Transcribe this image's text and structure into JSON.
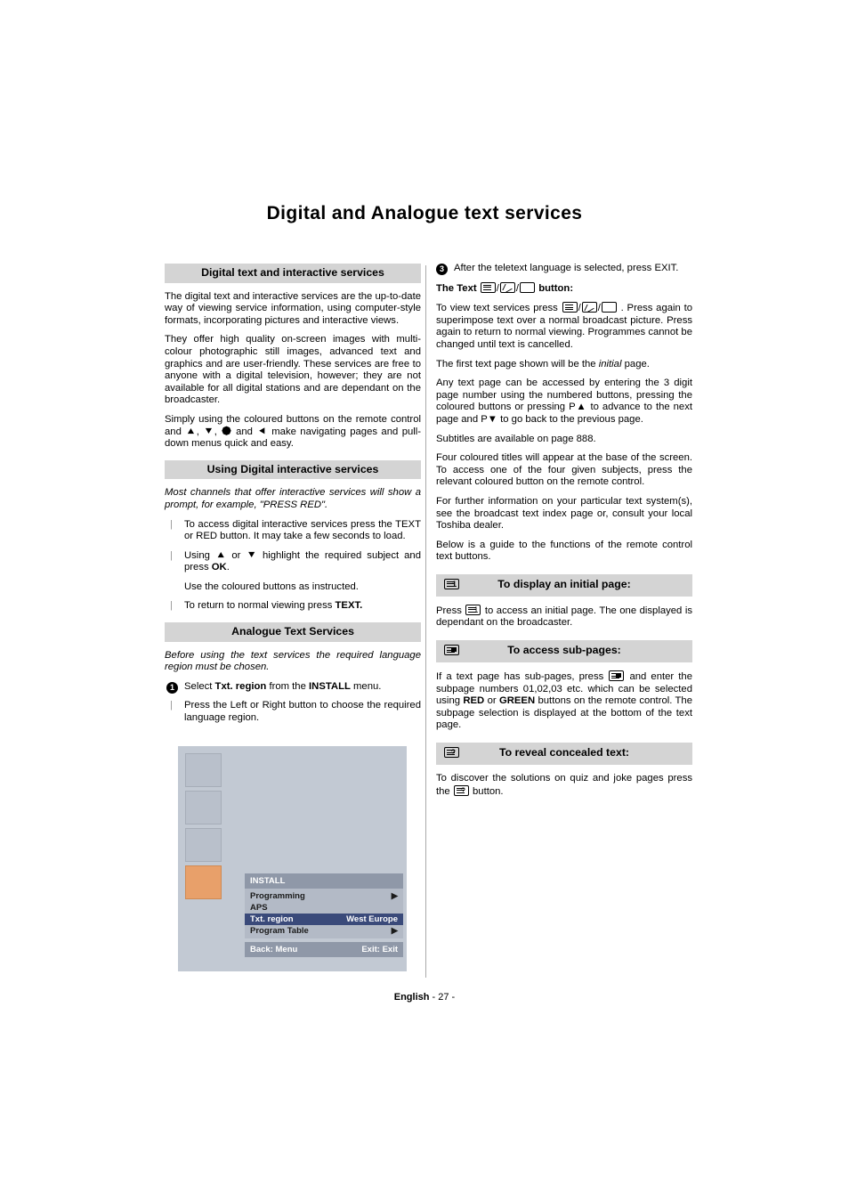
{
  "page": {
    "title": "Digital and Analogue text services",
    "footer_lang": "English",
    "footer_page": "- 27 -"
  },
  "left_column": {
    "sections": [
      {
        "heading": "Digital text and interactive services",
        "paragraphs": [
          "The digital text and interactive services are the up-to-date way of viewing service information, using computer-style formats, incorporating pictures and interactive views.",
          "They offer high quality on-screen images with multi-colour photographic still images, advanced text and graphics and are user-friendly. These services are free to anyone with a digital television, however; they are not available for all digital stations and are dependant on the broadcaster."
        ],
        "nav_text_before": "Simply using the coloured buttons on the remote control and",
        "nav_text_mid": "and",
        "nav_text_after": "make navigating pages and pull-down menus quick and easy."
      },
      {
        "heading": "Using Digital interactive services",
        "intro": "Most channels that offer interactive services will show a prompt, for example, \"PRESS RED\".",
        "items": [
          "To access digital interactive services press the TEXT or RED button. It may take a few seconds to load.",
          "Use the coloured buttons as instructed."
        ],
        "item_using_pre": "Using",
        "item_using_or": "or",
        "item_using_post": "highlight the required subject and press",
        "item_using_ok": "OK",
        "item_return_pre": "To return to normal viewing press",
        "item_return_bold": "TEXT."
      },
      {
        "heading": "Analogue Text Services",
        "intro": "Before using the text services the required language region must be chosen.",
        "step1_pre": "Select",
        "step1_bold1": "Txt. region",
        "step1_mid": "from the",
        "step1_bold2": "INSTALL",
        "step1_post": "menu.",
        "step2": "Press the Left or Right button to choose the required language region."
      }
    ]
  },
  "osd": {
    "title": "INSTALL",
    "rows": [
      {
        "label": "Programming",
        "value": "▶",
        "highlight": false
      },
      {
        "label": "APS",
        "value": "",
        "highlight": false
      },
      {
        "label": "Txt. region",
        "value": "West Europe",
        "highlight": true
      },
      {
        "label": "Program Table",
        "value": "▶",
        "highlight": false
      }
    ],
    "footer_back": "Back: Menu",
    "footer_exit": "Exit: Exit",
    "icons": [
      "music-icon",
      "picture-icon",
      "tools-icon",
      "channel-install-icon"
    ]
  },
  "right_column": {
    "step3": "After the teletext language is selected, press EXIT.",
    "text_button_heading_pre": "The Text",
    "text_button_heading_post": "button:",
    "paragraphs": [
      "To view text services press □/□/□ . Press again to superimpose text over a normal broadcast picture. Press again to return to normal viewing. Programmes cannot be changed until text is cancelled.",
      "The first text page shown will be the initial page.",
      "Any text page can be accessed by entering the 3 digit page number using the numbered buttons, pressing the coloured buttons or pressing P▲ to advance to the next page and P▼ to go back to the previous page.",
      "Subtitles are available on page 888.",
      "Four coloured titles will appear at the base of the screen. To access one of the four given subjects, press the relevant coloured button on the remote control.",
      "For further information on your particular text system(s), see the broadcast text index page or, consult your local Toshiba dealer.",
      "Below is a guide to the functions of the remote control text buttons."
    ],
    "para_view_pre": "To view text services press",
    "para_view_post": ". Press again to superimpose text over a normal broadcast picture. Press again to return to normal viewing. Programmes cannot be changed until text is cancelled.",
    "para_first_pre": "The first text page shown will be the",
    "para_first_ital": "initial",
    "para_first_post": "page.",
    "sections": [
      {
        "heading": "To display an initial page:",
        "body_pre": "Press",
        "body_post": "to access an initial page. The one displayed is dependant on the broadcaster."
      },
      {
        "heading": "To access sub-pages:",
        "body_pre": "If a text page has sub-pages, press",
        "body_mid": "and enter the subpage numbers 01,02,03 etc. which can be selected using",
        "body_red": "RED",
        "body_or": "or",
        "body_green": "GREEN",
        "body_post": "buttons on the remote control. The subpage selection is displayed at the bottom of the text page."
      },
      {
        "heading": "To reveal concealed text:",
        "body_pre": "To discover the solutions on quiz and joke pages press the",
        "body_post": "button."
      }
    ]
  }
}
